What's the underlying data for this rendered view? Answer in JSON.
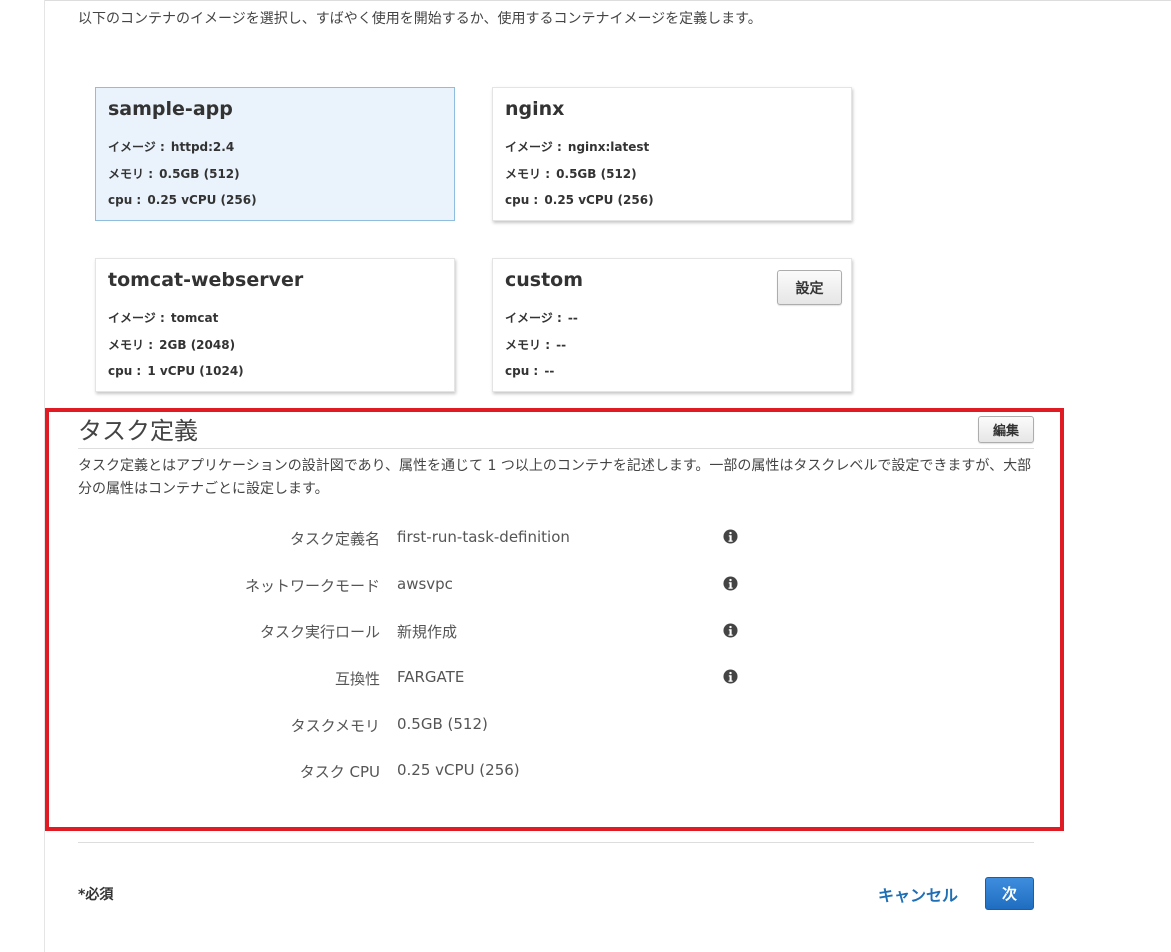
{
  "intro_text": "以下のコンテナのイメージを選択し、すばやく使用を開始するか、使用するコンテナイメージを定義します。",
  "container_cards": [
    {
      "name": "sample-app",
      "image_label": "イメージ",
      "image": "httpd:2.4",
      "memory_label": "メモリ",
      "memory": "0.5GB (512)",
      "cpu_label": "cpu",
      "cpu": "0.25 vCPU (256)",
      "selected": true
    },
    {
      "name": "nginx",
      "image_label": "イメージ",
      "image": "nginx:latest",
      "memory_label": "メモリ",
      "memory": "0.5GB (512)",
      "cpu_label": "cpu",
      "cpu": "0.25 vCPU (256)",
      "selected": false
    },
    {
      "name": "tomcat-webserver",
      "image_label": "イメージ",
      "image": "tomcat",
      "memory_label": "メモリ",
      "memory": "2GB (2048)",
      "cpu_label": "cpu",
      "cpu": "1 vCPU (1024)",
      "selected": false
    },
    {
      "name": "custom",
      "image_label": "イメージ",
      "image": "--",
      "memory_label": "メモリ",
      "memory": "--",
      "cpu_label": "cpu",
      "cpu": "--",
      "selected": false,
      "configure_label": "設定"
    }
  ],
  "task_definition": {
    "title": "タスク定義",
    "edit_label": "編集",
    "description": "タスク定義とはアプリケーションの設計図であり、属性を通じて 1 つ以上のコンテナを記述します。一部の属性はタスクレベルで設定できますが、大部分の属性はコンテナごとに設定します。",
    "fields": [
      {
        "label": "タスク定義名",
        "value": "first-run-task-definition",
        "has_info": true
      },
      {
        "label": "ネットワークモード",
        "value": "awsvpc",
        "has_info": true
      },
      {
        "label": "タスク実行ロール",
        "value": "新規作成",
        "has_info": true
      },
      {
        "label": "互換性",
        "value": "FARGATE",
        "has_info": true
      },
      {
        "label": "タスクメモリ",
        "value": "0.5GB (512)",
        "has_info": false
      },
      {
        "label": "タスク CPU",
        "value": "0.25 vCPU (256)",
        "has_info": false
      }
    ]
  },
  "footer": {
    "required_label": "*必須",
    "cancel_label": "キャンセル",
    "next_label": "次"
  },
  "colors": {
    "highlight_border": "#e01b24",
    "selected_card_bg": "#eaf3fb",
    "primary_button": "#2a7bd0",
    "link": "#1f6fb5"
  },
  "icons": {
    "field_info": "info-circle-icon"
  }
}
